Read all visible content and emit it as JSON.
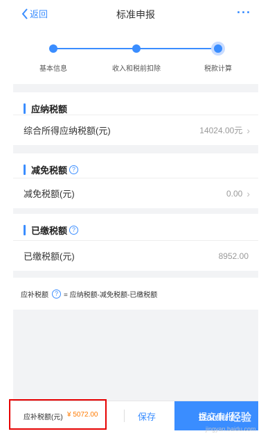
{
  "header": {
    "back_label": "返回",
    "title": "标准申报",
    "more_label": "···"
  },
  "stepper": {
    "steps": [
      {
        "label": "基本信息",
        "state": "done"
      },
      {
        "label": "收入和税前扣除",
        "state": "done"
      },
      {
        "label": "税款计算",
        "state": "current"
      }
    ]
  },
  "sections": [
    {
      "title": "应纳税额",
      "has_help": false,
      "row": {
        "label": "综合所得应纳税额(元)",
        "value": "14024.00元",
        "chevron": true
      }
    },
    {
      "title": "减免税额",
      "has_help": true,
      "row": {
        "label": "减免税额(元)",
        "value": "0.00",
        "chevron": true
      }
    },
    {
      "title": "已缴税额",
      "has_help": true,
      "row": {
        "label": "已缴税额(元)",
        "value": "8952.00",
        "chevron": false
      }
    }
  ],
  "formula": {
    "label": "应补税额",
    "expression": "= 应纳税额-减免税额-已缴税额"
  },
  "bottom_bar": {
    "due_label": "应补税额(元)",
    "due_value": "¥ 5072.00",
    "save_label": "保存",
    "submit_label": "提交申报"
  },
  "watermark": {
    "text": "Baidu 经验",
    "sub": "jingyan.baidu.com"
  },
  "colors": {
    "accent": "#3a8dff",
    "amount": "#ff7a00",
    "highlight": "#e60000",
    "background_gap": "#f2f3f5"
  }
}
